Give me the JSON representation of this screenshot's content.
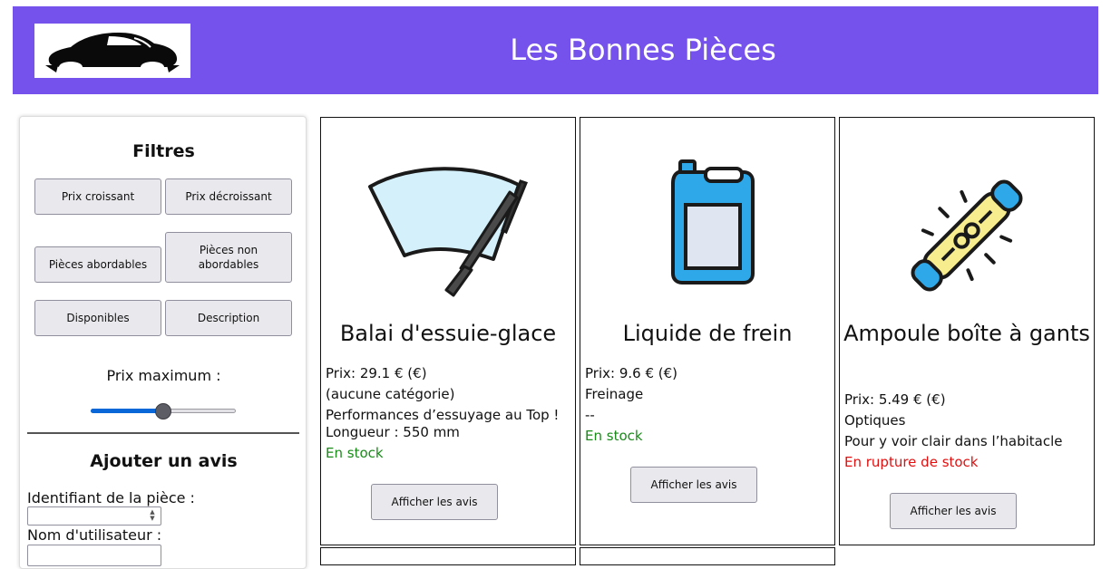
{
  "header": {
    "title": "Les Bonnes Pièces",
    "logo_icon": "car-silhouette-icon",
    "background_color": "#7652ec"
  },
  "filters": {
    "title": "Filtres",
    "buttons": [
      {
        "label": "Prix croissant"
      },
      {
        "label": "Prix décroissant"
      },
      {
        "label": "Pièces abordables"
      },
      {
        "label": "Pièces non abordables"
      },
      {
        "label": "Disponibles"
      },
      {
        "label": "Description"
      }
    ],
    "max_price_label": "Prix maximum :",
    "max_price_slider_level": 0.5
  },
  "review_form": {
    "title": "Ajouter un avis",
    "piece_id_label": "Identifiant de la pièce :",
    "piece_id_value": "",
    "username_label": "Nom d'utilisateur :",
    "username_value": ""
  },
  "cards": [
    {
      "name": "Balai d'essuie-glace",
      "price": "Prix: 29.1 € (€)",
      "category": "(aucune catégorie)",
      "description": "Performances d’essuyage au Top ! Longueur : 550 mm",
      "stock": "En stock",
      "in_stock": true,
      "button": "Afficher les avis",
      "icon": "wiper-blade-icon"
    },
    {
      "name": "Liquide de frein",
      "price": "Prix: 9.6 € (€)",
      "category": "Freinage",
      "description": "--",
      "stock": "En stock",
      "in_stock": true,
      "button": "Afficher les avis",
      "icon": "fluid-canister-icon"
    },
    {
      "name": "Ampoule boîte à gants",
      "price": "Prix: 5.49 € (€)",
      "category": "Optiques",
      "description": "Pour y voir clair dans l’habitacle",
      "stock": "En rupture de stock",
      "in_stock": false,
      "button": "Afficher les avis",
      "icon": "light-bulb-icon"
    }
  ],
  "colors": {
    "in_stock": "#1a8a1a",
    "out_of_stock": "#e01010",
    "slider_fill": "#0a67d8"
  }
}
